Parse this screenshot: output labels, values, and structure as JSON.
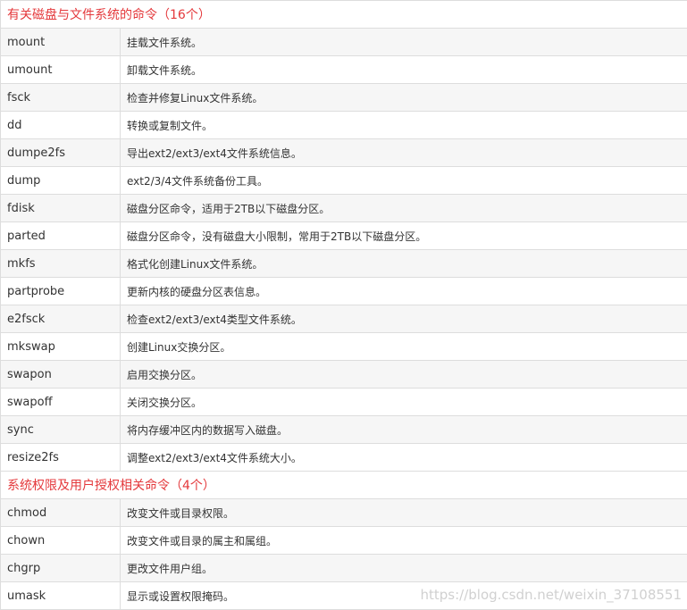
{
  "sections": [
    {
      "title": "有关磁盘与文件系统的命令（16个）",
      "rows": [
        {
          "cmd": "mount",
          "desc": "挂载文件系统。"
        },
        {
          "cmd": "umount",
          "desc": "卸载文件系统。"
        },
        {
          "cmd": "fsck",
          "desc": "检查并修复Linux文件系统。"
        },
        {
          "cmd": "dd",
          "desc": "转换或复制文件。"
        },
        {
          "cmd": "dumpe2fs",
          "desc": "导出ext2/ext3/ext4文件系统信息。"
        },
        {
          "cmd": "dump",
          "desc": "ext2/3/4文件系统备份工具。"
        },
        {
          "cmd": "fdisk",
          "desc": "磁盘分区命令，适用于2TB以下磁盘分区。"
        },
        {
          "cmd": "parted",
          "desc": "磁盘分区命令，没有磁盘大小限制，常用于2TB以下磁盘分区。"
        },
        {
          "cmd": "mkfs",
          "desc": "格式化创建Linux文件系统。"
        },
        {
          "cmd": "partprobe",
          "desc": "更新内核的硬盘分区表信息。"
        },
        {
          "cmd": "e2fsck",
          "desc": "检查ext2/ext3/ext4类型文件系统。"
        },
        {
          "cmd": "mkswap",
          "desc": "创建Linux交换分区。"
        },
        {
          "cmd": "swapon",
          "desc": "启用交换分区。"
        },
        {
          "cmd": "swapoff",
          "desc": "关闭交换分区。"
        },
        {
          "cmd": "sync",
          "desc": "将内存缓冲区内的数据写入磁盘。"
        },
        {
          "cmd": "resize2fs",
          "desc": "调整ext2/ext3/ext4文件系统大小。"
        }
      ]
    },
    {
      "title": "系统权限及用户授权相关命令（4个）",
      "rows": [
        {
          "cmd": "chmod",
          "desc": "改变文件或目录权限。"
        },
        {
          "cmd": "chown",
          "desc": "改变文件或目录的属主和属组。"
        },
        {
          "cmd": "chgrp",
          "desc": "更改文件用户组。"
        },
        {
          "cmd": "umask",
          "desc": "显示或设置权限掩码。"
        }
      ]
    }
  ],
  "watermark": "https://blog.csdn.net/weixin_37108551"
}
